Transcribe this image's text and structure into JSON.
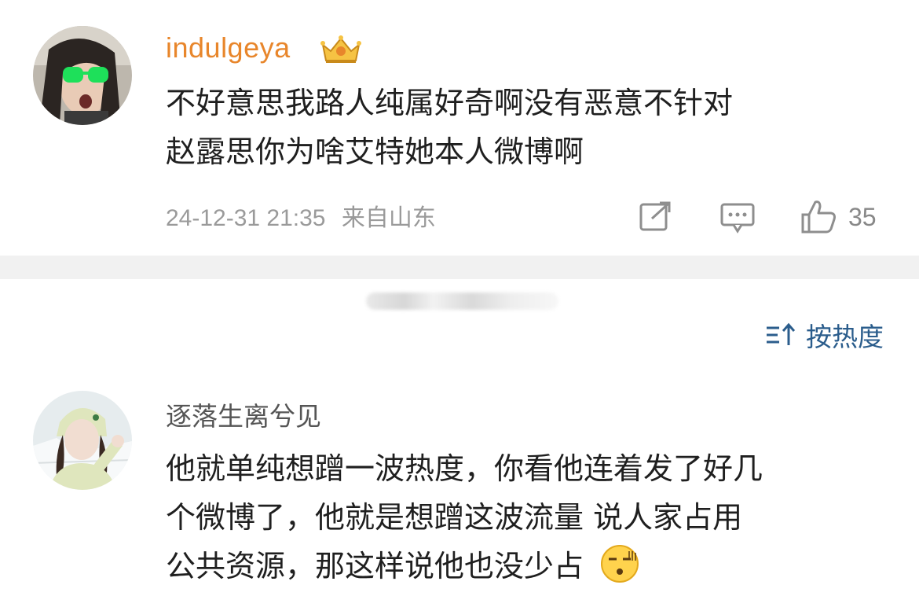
{
  "comments": [
    {
      "username": "indulgeya",
      "badge_icon": "crown-vip-icon",
      "text_lines": [
        "不好意思我路人纯属好奇啊没有恶意不针对",
        "赵露思你为啥艾特她本人微博啊"
      ],
      "timestamp": "24-12-31 21:35",
      "location": "来自山东",
      "like_count": "35"
    },
    {
      "username": "逐落生离兮见",
      "text_lines": [
        "他就单纯想蹭一波热度，你看他连着发了好几",
        "个微博了，他就是想蹭这波流量 说人家占用",
        "公共资源，那这样说他也没少占"
      ],
      "emoji": "speechless-face-emoji"
    }
  ],
  "sort": {
    "label": "按热度",
    "icon": "sort-icon"
  },
  "colors": {
    "username_vip": "#e8862b",
    "link": "#2b5d8c",
    "meta": "#9a9a9a"
  }
}
